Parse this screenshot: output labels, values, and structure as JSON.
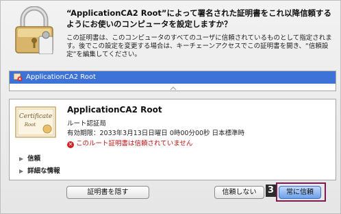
{
  "dialog": {
    "title": "“ApplicationCA2 Root”によって署名された証明書をこれ以降信頼するようにお使いのコンピュータを設定しますか？",
    "description": "この証明書は、このコンピュータのすべてのユーザに信頼されているものとして指定されます。後でこの設定を変更する場合は、キーチェーンアクセスでこの証明書を開き、“信頼設定”を編集してください。"
  },
  "cert_list": {
    "items": [
      {
        "label": "ApplicationCA2 Root",
        "icon": "certificate-warning-icon"
      }
    ]
  },
  "cert_detail": {
    "name": "ApplicationCA2 Root",
    "type": "ルート認証局",
    "expiry": "有効期限：2033年3月13日日曜日 0時00分00秒 日本標準時",
    "warning": "このルート証明書は信頼されていません",
    "image_script_text": "Certificate",
    "image_script_sub": "Root",
    "disclosures": [
      {
        "label": "信頼"
      },
      {
        "label": "詳細な情報"
      }
    ]
  },
  "buttons": {
    "hide": "証明書を隠す",
    "deny": "信頼しない",
    "always": "常に信頼"
  },
  "callout": {
    "number": "3"
  },
  "colors": {
    "selection": "#3d72d7",
    "warning": "#c01010",
    "callout_frame": "#7a1a55",
    "default_button": "#6ea0ea"
  }
}
